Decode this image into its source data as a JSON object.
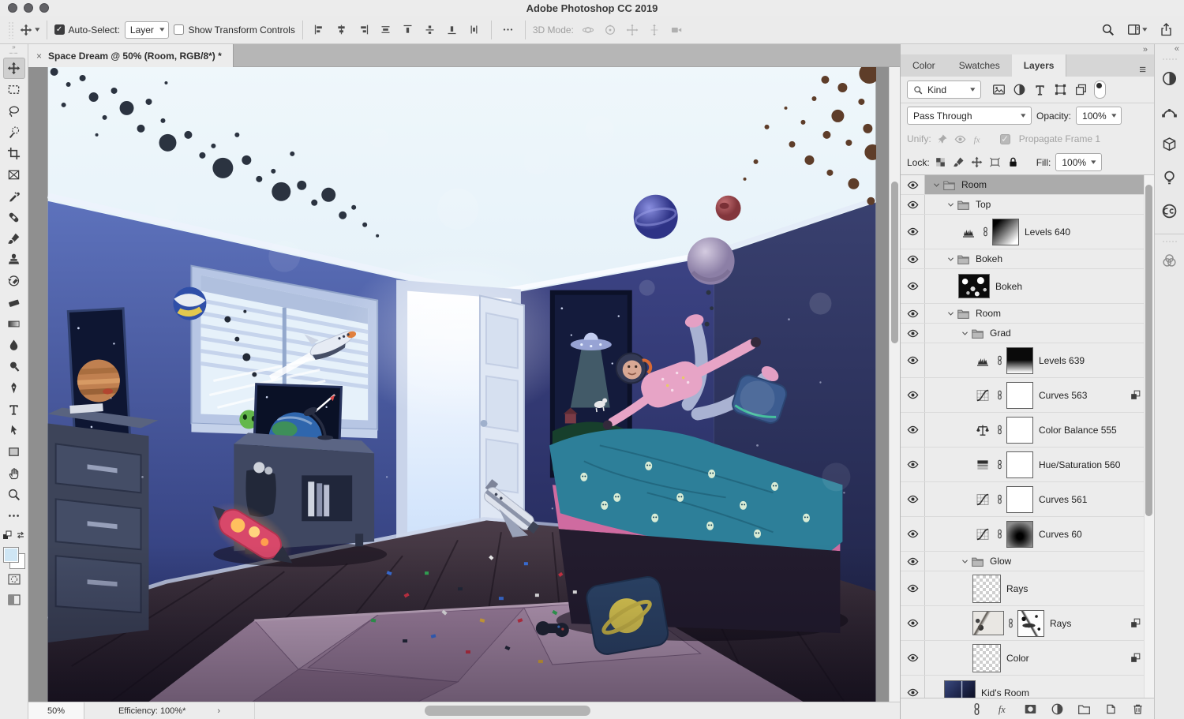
{
  "window": {
    "title": "Adobe Photoshop CC 2019"
  },
  "options_bar": {
    "tool_icon": "move",
    "auto_select": {
      "label": "Auto-Select:",
      "checked": true,
      "value": "Layer"
    },
    "show_transform": {
      "label": "Show Transform Controls",
      "checked": false
    },
    "align_icons": [
      {
        "name": "align-left-edges-icon",
        "icon": "alignL"
      },
      {
        "name": "align-horizontal-centers-icon",
        "icon": "alignC"
      },
      {
        "name": "align-right-edges-icon",
        "icon": "alignR"
      },
      {
        "name": "align-center-content-icon",
        "icon": "alignJ"
      },
      {
        "name": "align-top-edges-icon",
        "icon": "distT"
      },
      {
        "name": "distribute-vertical-centers-icon",
        "icon": "distM"
      },
      {
        "name": "align-bottom-edges-icon",
        "icon": "distB"
      },
      {
        "name": "distribute-horizontal-centers-icon",
        "icon": "distV"
      }
    ],
    "more_icon": "ellipsis",
    "mode_label": "3D Mode:",
    "mode_icons": [
      {
        "name": "3d-orbit-icon",
        "icon": "orbit"
      },
      {
        "name": "3d-roll-icon",
        "icon": "roll"
      },
      {
        "name": "3d-pan-icon",
        "icon": "pan3d"
      },
      {
        "name": "3d-slide-icon",
        "icon": "slide3d"
      },
      {
        "name": "3d-camera-icon",
        "icon": "camera"
      }
    ],
    "right_icons": [
      {
        "name": "search-icon",
        "icon": "search"
      },
      {
        "name": "workspace-switcher-icon",
        "icon": "workspace"
      },
      {
        "name": "share-icon",
        "icon": "share"
      }
    ]
  },
  "document_tab": {
    "close": "×",
    "title": "Space Dream @ 50% (Room, RGB/8*) *"
  },
  "tools": [
    {
      "name": "move-tool",
      "icon": "move",
      "selected": true
    },
    {
      "name": "rectangular-marquee-tool",
      "icon": "marquee"
    },
    {
      "name": "lasso-tool",
      "icon": "lasso"
    },
    {
      "name": "quick-selection-tool",
      "icon": "quickselect"
    },
    {
      "name": "crop-tool",
      "icon": "crop"
    },
    {
      "name": "frame-tool",
      "icon": "frame"
    },
    {
      "name": "eyedropper-tool",
      "icon": "eyedropper"
    },
    {
      "name": "spot-healing-brush-tool",
      "icon": "healing"
    },
    {
      "name": "brush-tool",
      "icon": "brush"
    },
    {
      "name": "clone-stamp-tool",
      "icon": "clone"
    },
    {
      "name": "history-brush-tool",
      "icon": "historybrush"
    },
    {
      "name": "eraser-tool",
      "icon": "eraser"
    },
    {
      "name": "gradient-tool",
      "icon": "gradient"
    },
    {
      "name": "blur-tool",
      "icon": "blur"
    },
    {
      "name": "dodge-tool",
      "icon": "dodge"
    },
    {
      "name": "pen-tool",
      "icon": "pen"
    },
    {
      "name": "type-tool",
      "icon": "type"
    },
    {
      "name": "path-selection-tool",
      "icon": "pathselect"
    },
    {
      "name": "rectangle-tool",
      "icon": "rectangle"
    },
    {
      "name": "hand-tool",
      "icon": "hand"
    },
    {
      "name": "zoom-tool",
      "icon": "zoom"
    },
    {
      "name": "edit-toolbar-button",
      "icon": "ellipsis"
    }
  ],
  "tool_footer": {
    "foreground_color": "#cfe6f4",
    "background_color": "#ffffff"
  },
  "status_bar": {
    "zoom": "50%",
    "efficiency": "Efficiency: 100%*",
    "chevron": "›"
  },
  "panel": {
    "collapse_glyph": "»",
    "tabs": [
      {
        "label": "Color",
        "active": false
      },
      {
        "label": "Swatches",
        "active": false
      },
      {
        "label": "Layers",
        "active": true
      }
    ],
    "menu_glyph": "≡",
    "filter": {
      "kind": "Kind",
      "icons": [
        {
          "name": "filter-pixel-layers-icon",
          "icon": "pic"
        },
        {
          "name": "filter-adjustment-layers-icon",
          "icon": "halfcircle"
        },
        {
          "name": "filter-type-layers-icon",
          "icon": "typeT"
        },
        {
          "name": "filter-shape-layers-icon",
          "icon": "shape"
        },
        {
          "name": "filter-smart-objects-icon",
          "icon": "smartobj"
        }
      ]
    },
    "blend": {
      "value": "Pass Through",
      "opacity_label": "Opacity:",
      "opacity": "100%"
    },
    "unify": {
      "label": "Unify:",
      "icons": [
        {
          "name": "unify-position-icon",
          "icon": "pin"
        },
        {
          "name": "unify-visibility-icon",
          "icon": "eye"
        },
        {
          "name": "unify-style-icon",
          "icon": "fxg"
        }
      ],
      "propagate": "Propagate Frame 1",
      "propagate_checked": true
    },
    "lock": {
      "label": "Lock:",
      "icons": [
        {
          "name": "lock-transparent-pixels-icon",
          "icon": "checker"
        },
        {
          "name": "lock-image-pixels-icon",
          "icon": "brush"
        },
        {
          "name": "lock-position-icon",
          "icon": "move"
        },
        {
          "name": "lock-artboard-icon",
          "icon": "frameS"
        },
        {
          "name": "lock-all-icon",
          "icon": "lock"
        }
      ],
      "fill_label": "Fill:",
      "fill": "100%"
    },
    "layers": [
      {
        "kind": "group",
        "depth": 0,
        "label": "Room",
        "expanded": true,
        "selected": true
      },
      {
        "kind": "group",
        "depth": 1,
        "label": "Top",
        "expanded": true
      },
      {
        "kind": "adjustment",
        "depth": 2,
        "label": "Levels 640",
        "icon": "levels",
        "mask": "grad-diag"
      },
      {
        "kind": "group",
        "depth": 1,
        "label": "Bokeh",
        "expanded": true
      },
      {
        "kind": "pixel",
        "depth": 2,
        "label": "Bokeh",
        "thumb": "bokeh"
      },
      {
        "kind": "group",
        "depth": 1,
        "label": "Room",
        "expanded": true
      },
      {
        "kind": "group",
        "depth": 2,
        "label": "Grad",
        "expanded": true
      },
      {
        "kind": "adjustment",
        "depth": 3,
        "label": "Levels 639",
        "icon": "levels",
        "mask": "grad-vert"
      },
      {
        "kind": "adjustment",
        "depth": 3,
        "label": "Curves 563",
        "icon": "curves",
        "mask": "white",
        "clipped": true
      },
      {
        "kind": "adjustment",
        "depth": 3,
        "label": "Color Balance 555",
        "icon": "colorbalance",
        "mask": "white"
      },
      {
        "kind": "adjustment",
        "depth": 3,
        "label": "Hue/Saturation 560",
        "icon": "huesat",
        "mask": "white"
      },
      {
        "kind": "adjustment",
        "depth": 3,
        "label": "Curves 561",
        "icon": "curves",
        "mask": "white"
      },
      {
        "kind": "adjustment",
        "depth": 3,
        "label": "Curves 60",
        "icon": "curves",
        "mask": "radial"
      },
      {
        "kind": "group",
        "depth": 2,
        "label": "Glow",
        "expanded": true
      },
      {
        "kind": "pixel",
        "depth": 3,
        "label": "Rays",
        "thumb": "transparent"
      },
      {
        "kind": "pixel",
        "depth": 3,
        "label": "Rays",
        "thumb": "rays",
        "mask": "rays-mask",
        "clipped": true
      },
      {
        "kind": "pixel",
        "depth": 3,
        "label": "Color",
        "thumb": "transparent",
        "clipped": true
      },
      {
        "kind": "pixel",
        "depth": 1,
        "label": "Kid's Room",
        "thumb": "kidsroom"
      }
    ],
    "footer_icons": [
      {
        "name": "link-layers-icon",
        "icon": "chain"
      },
      {
        "name": "layer-styles-icon",
        "icon": "fxg"
      },
      {
        "name": "add-layer-mask-icon",
        "icon": "mask"
      },
      {
        "name": "new-adjustment-layer-icon",
        "icon": "halfcircle"
      },
      {
        "name": "new-group-icon",
        "icon": "folderS"
      },
      {
        "name": "new-layer-icon",
        "icon": "newlayer"
      },
      {
        "name": "delete-layer-icon",
        "icon": "trash"
      }
    ]
  },
  "dock": {
    "collapse_glyph": "«",
    "icons": [
      {
        "name": "adjustments-panel-icon",
        "icon": "halfcircle"
      },
      {
        "name": "paths-panel-icon",
        "icon": "bezier"
      },
      {
        "name": "3d-panel-icon",
        "icon": "cube"
      },
      {
        "name": "learn-panel-icon",
        "icon": "bulb"
      },
      {
        "name": "libraries-panel-icon",
        "icon": "cc"
      }
    ],
    "icons2": [
      {
        "name": "channels-panel-icon",
        "icon": "venn"
      }
    ]
  },
  "colors": {
    "selected_row": "#ababab",
    "pasteboard": "#8f8f8f",
    "foreground_swatch": "#cfe6f4"
  }
}
